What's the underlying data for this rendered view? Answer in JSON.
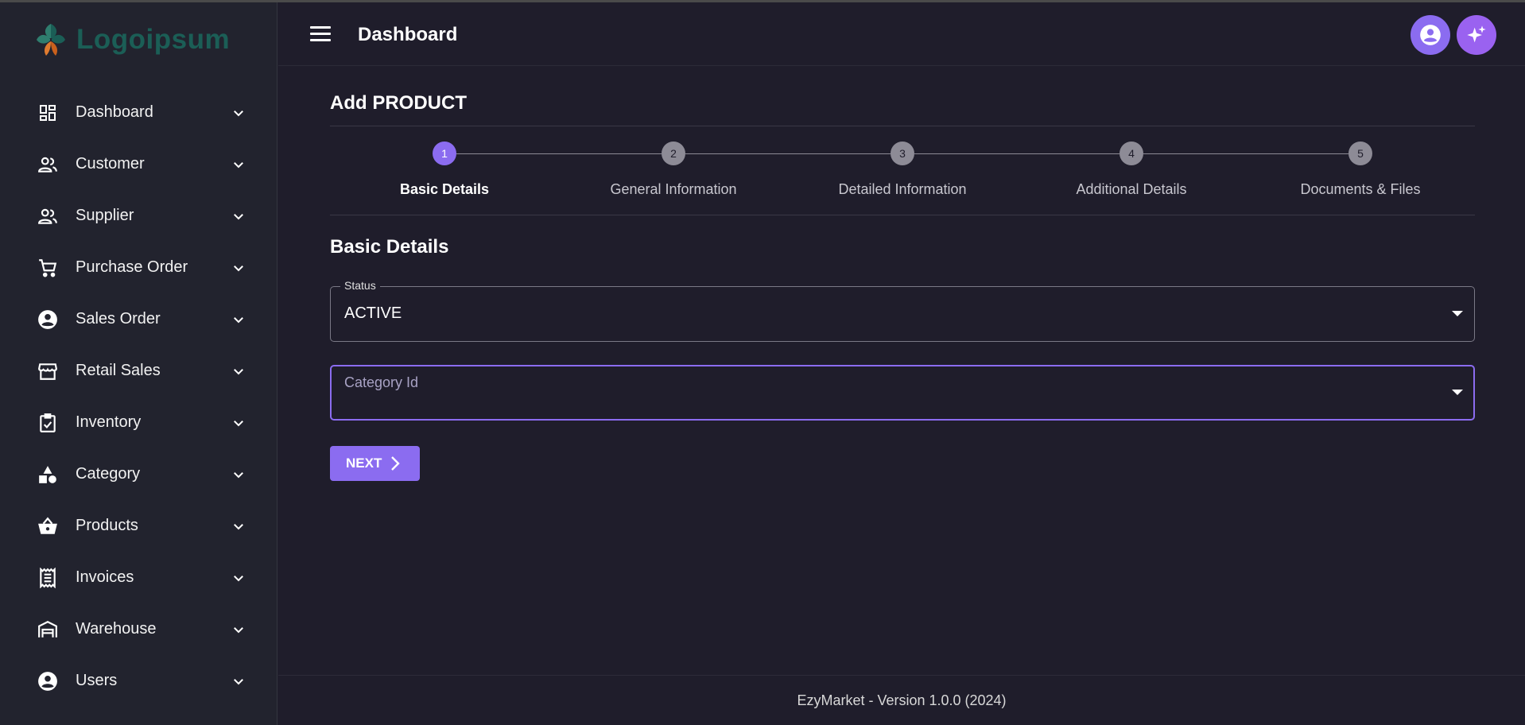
{
  "app": {
    "logo_text": "Logoipsum",
    "page_title": "Dashboard",
    "accent_color": "#8b6cf0"
  },
  "sidebar": {
    "items": [
      {
        "label": "Dashboard",
        "icon": "dashboard-icon"
      },
      {
        "label": "Customer",
        "icon": "people-icon"
      },
      {
        "label": "Supplier",
        "icon": "people-icon"
      },
      {
        "label": "Purchase Order",
        "icon": "cart-icon"
      },
      {
        "label": "Sales Order",
        "icon": "account-circle-icon"
      },
      {
        "label": "Retail Sales",
        "icon": "storefront-icon"
      },
      {
        "label": "Inventory",
        "icon": "clipboard-check-icon"
      },
      {
        "label": "Category",
        "icon": "shapes-icon"
      },
      {
        "label": "Products",
        "icon": "basket-icon"
      },
      {
        "label": "Invoices",
        "icon": "receipt-icon"
      },
      {
        "label": "Warehouse",
        "icon": "warehouse-icon"
      },
      {
        "label": "Users",
        "icon": "account-circle-icon"
      }
    ]
  },
  "form": {
    "title": "Add PRODUCT",
    "steps": [
      {
        "num": "1",
        "label": "Basic Details",
        "active": true
      },
      {
        "num": "2",
        "label": "General Information",
        "active": false
      },
      {
        "num": "3",
        "label": "Detailed Information",
        "active": false
      },
      {
        "num": "4",
        "label": "Additional Details",
        "active": false
      },
      {
        "num": "5",
        "label": "Documents & Files",
        "active": false
      }
    ],
    "section_title": "Basic Details",
    "status": {
      "legend": "Status",
      "value": "ACTIVE"
    },
    "category": {
      "placeholder": "Category Id",
      "value": ""
    },
    "next_label": "NEXT"
  },
  "footer": {
    "text": "EzyMarket - Version 1.0.0 (2024)"
  }
}
